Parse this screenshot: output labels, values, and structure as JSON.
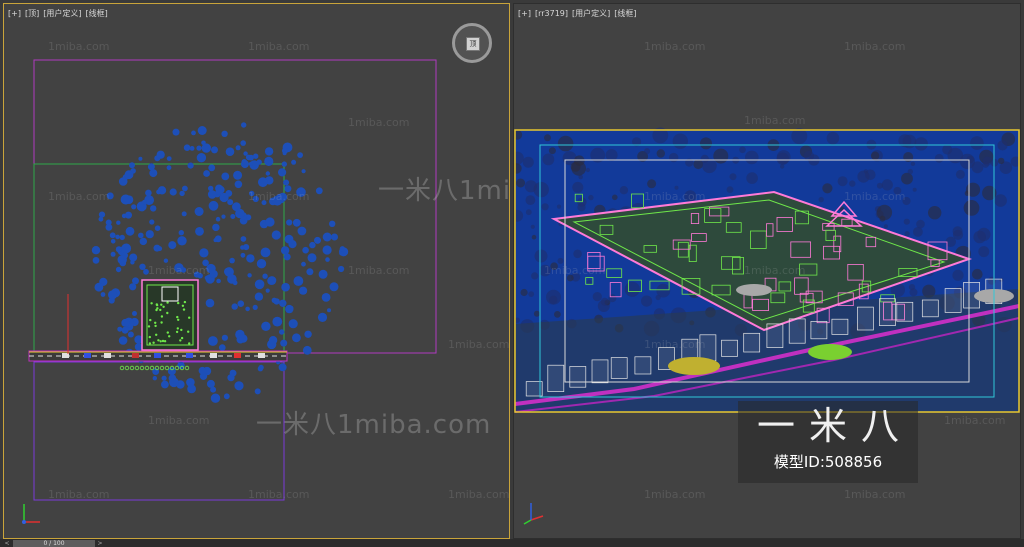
{
  "left_viewport": {
    "labels": [
      "[+]",
      "[顶]",
      "[用户定义]",
      "[线框]"
    ],
    "viewcube_label": "顶"
  },
  "right_viewport": {
    "labels": [
      "[+]",
      "[rr3719]",
      "[用户定义]",
      "[线框]"
    ]
  },
  "watermark": {
    "small_text": "1miba.com",
    "large_text": "一米八1miba.com"
  },
  "brand": {
    "logo_text": "一米八",
    "model_id_text": "模型ID:508856"
  },
  "timeline": {
    "slider_text": "0 / 100",
    "prev_arrow": "<",
    "next_arrow": ">"
  },
  "colors": {
    "viewport_bg": "#424242",
    "active_border": "#c9a43a",
    "trees": "#1d4fb8",
    "boundary": "#b03ac0",
    "wireframe_green": "#6fe84a",
    "wireframe_pink": "#ff7ad8",
    "road": "#c030c0",
    "highlight_frame": "#e8c830",
    "inner_frame_cyan": "#30c8d8"
  }
}
